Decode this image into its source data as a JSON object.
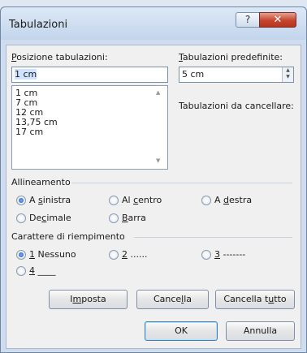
{
  "window": {
    "title": "Tabulazioni",
    "help_label": "?",
    "close_label": "✕"
  },
  "positions": {
    "label_prefix": "",
    "label_underlined": "P",
    "label_rest": "osizione tabulazioni:",
    "current_value": "1 cm",
    "items": [
      "1 cm",
      "7 cm",
      "12 cm",
      "13,75 cm",
      "17 cm"
    ]
  },
  "defaults": {
    "label_underlined": "T",
    "label_rest": "abulazioni predefinite:",
    "value": "5 cm",
    "to_clear_label": "Tabulazioni da cancellare:"
  },
  "alignment": {
    "group_label": "Allineamento",
    "options": [
      {
        "pre": "A ",
        "u": "s",
        "post": "inistra",
        "checked": true
      },
      {
        "pre": "Al ",
        "u": "c",
        "post": "entro",
        "checked": false
      },
      {
        "pre": "A ",
        "u": "d",
        "post": "estra",
        "checked": false
      },
      {
        "pre": "De",
        "u": "c",
        "post": "imale",
        "checked": false
      },
      {
        "pre": "",
        "u": "B",
        "post": "arra",
        "checked": false
      }
    ]
  },
  "leader": {
    "group_label": "Carattere di riempimento",
    "options": [
      {
        "pre": "",
        "u": "1",
        "post": " Nessuno",
        "checked": true
      },
      {
        "pre": "",
        "u": "2",
        "post": " ......",
        "checked": false
      },
      {
        "pre": "",
        "u": "3",
        "post": " -------",
        "checked": false
      },
      {
        "pre": "",
        "u": "4",
        "post": " ____",
        "checked": false
      }
    ]
  },
  "buttons": {
    "set": {
      "pre": "I",
      "u": "m",
      "post": "posta"
    },
    "clear": {
      "pre": "Cance",
      "u": "l",
      "post": "la"
    },
    "clear_all": {
      "pre": "Cancella t",
      "u": "u",
      "post": "tto"
    },
    "ok": "OK",
    "cancel": "Annulla"
  }
}
